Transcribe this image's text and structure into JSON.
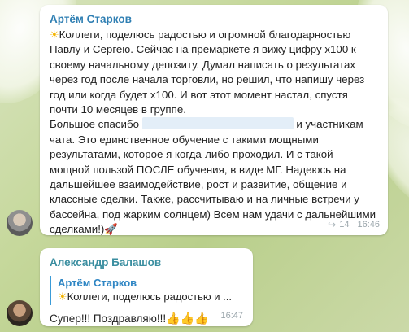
{
  "messages": [
    {
      "author": "Артём Старков",
      "icon": "sun-icon",
      "lines": [
        "Коллеги, поделюсь радостью и огромной благодарностью",
        "Павлу и Сергею. Сейчас на премаркете я вижу цифру x100 к",
        "своему начальному депозиту. Думал написать о результатах",
        "через год после начала торговли, но решил, что напишу через",
        "год или когда будет x100. И вот этот момент настал, спустя",
        "почти 10 месяцев в группе."
      ],
      "thanks_before": "Большое спасибо",
      "thanks_after": "и участникам",
      "lines_after": [
        "чата. Это единственное обучение с такими мощными",
        "результатами, которое я когда-либо проходил. И с такой",
        "мощной пользой ПОСЛЕ обучения, в виде МГ. Надеюсь на",
        "дальшейшее взаимодействие, рост и развитие, общение и",
        "классные сделки. Также, рассчитываю и на личные встречи у",
        "бассейна, под жарким солнцем) Всем нам удачи с дальнейшими",
        "сделками!)"
      ],
      "tail_icon": "rocket-icon",
      "views": "14",
      "time": "16:46"
    },
    {
      "author": "Александр Балашов",
      "reply": {
        "author": "Артём Старков",
        "icon": "sun-icon",
        "text": "Коллеги, поделюсь радостью и ..."
      },
      "text": "Супер!!! Поздравляю!!!",
      "thumbs": "👍👍👍",
      "time": "16:47"
    }
  ]
}
